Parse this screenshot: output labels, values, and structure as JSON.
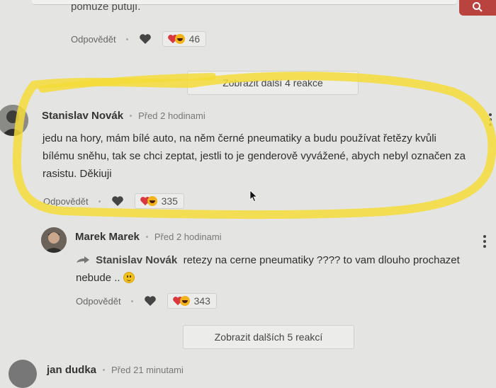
{
  "top": {
    "truncated_text": "pomůže putují."
  },
  "comment0": {
    "reply_label": "Odpovědět",
    "reaction_count": "46"
  },
  "more_button_1": {
    "label": "Zobrazit další 4 reakce"
  },
  "comment1": {
    "author": "Stanislav Novák",
    "time": "Před 2 hodinami",
    "lines": [
      "jedu na hory, mám bílé auto, na něm černé pneumatiky a budu používat řetězy kvůli",
      "bílému sněhu, tak se chci zeptat, jestli to je genderově vyvážené, abych nebyl označen za",
      "rasistu. Děkiuji"
    ],
    "reply_label": "Odpovědět",
    "reaction_count": "335"
  },
  "comment2": {
    "author": "Marek Marek",
    "time": "Před 2 hodinami",
    "mention": "Stanislav Novák",
    "text_line1": "retezy na cerne pneumatiky ???? to vam dlouho prochazet",
    "text_line2": "nebude ..",
    "reply_label": "Odpovědět",
    "reaction_count": "343"
  },
  "more_button_2": {
    "label": "Zobrazit dalších 5 reakcí"
  },
  "comment3": {
    "author": "jan dudka",
    "time": "Před 21 minutami"
  },
  "colors": {
    "highlight": "#f5dc3a",
    "heart": "#d9383f",
    "search_button": "#b8433f"
  }
}
